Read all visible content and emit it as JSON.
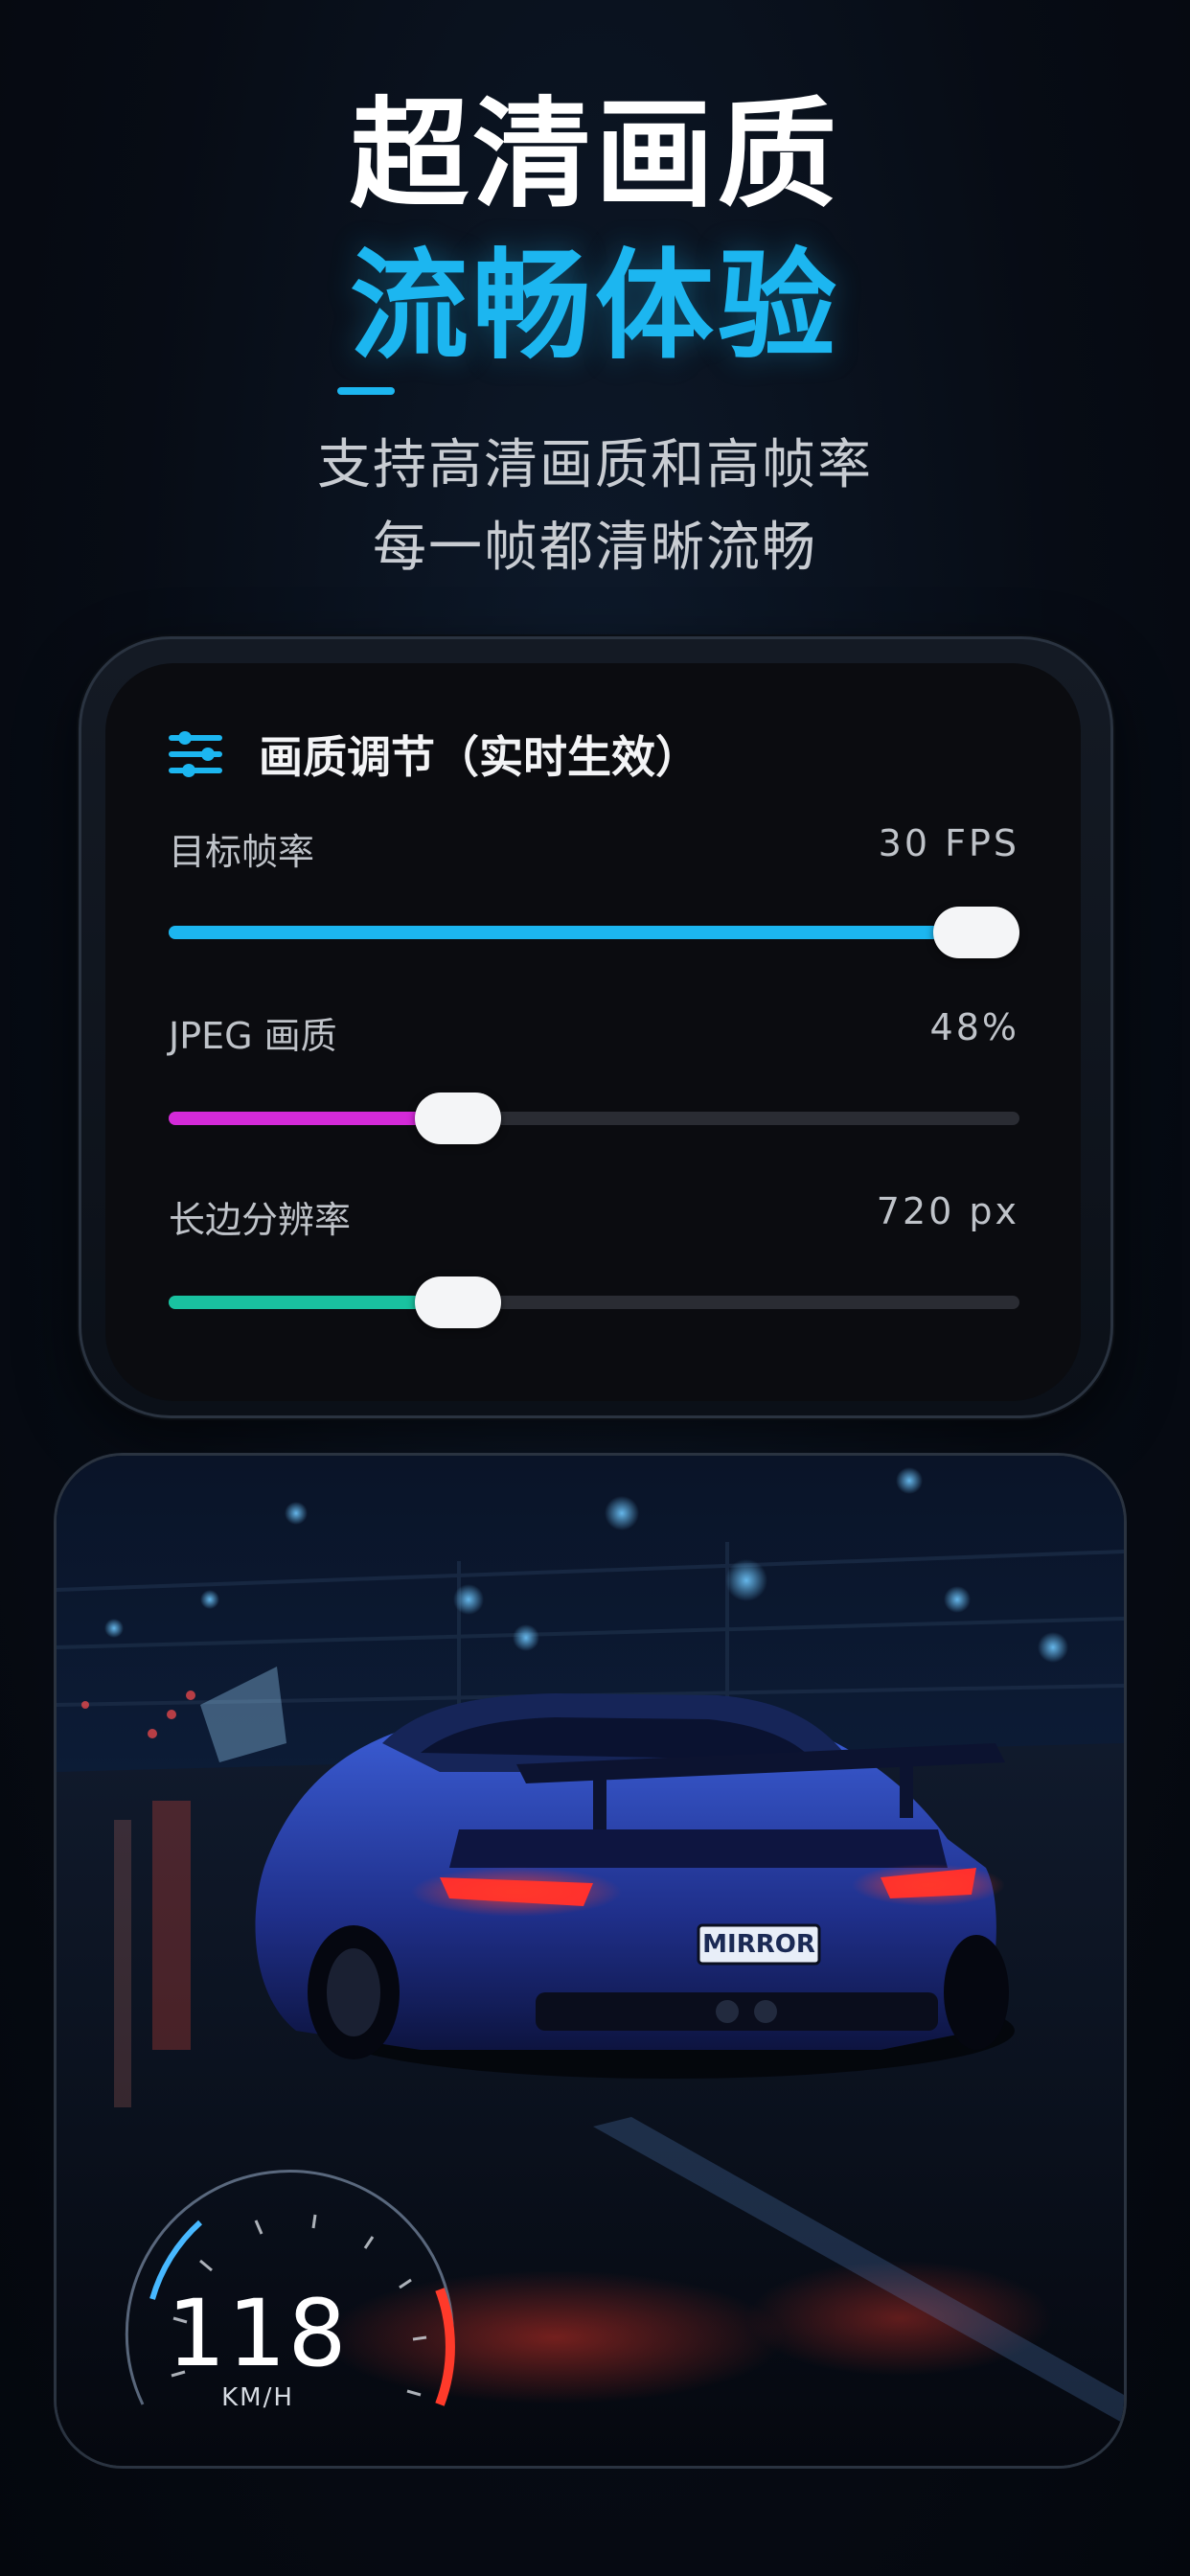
{
  "hero": {
    "title_line1": "超清画质",
    "title_line2": "流畅体验",
    "subtitle_line1": "支持高清画质和高帧率",
    "subtitle_line2": "每一帧都清晰流畅"
  },
  "settings_card": {
    "icon": "sliders-icon",
    "title": "画质调节（实时生效）",
    "sliders": [
      {
        "label": "目标帧率",
        "value": "30 FPS",
        "level": 0.95,
        "color": "#1cb6f0"
      },
      {
        "label": "JPEG 画质",
        "value": "48%",
        "level": 0.34,
        "color": "#d42ad9"
      },
      {
        "label": "长边分辨率",
        "value": "720 px",
        "level": 0.34,
        "color": "#19c2a0"
      }
    ]
  },
  "preview": {
    "plate": "MIRROR",
    "speed": "118",
    "speed_unit": "KM/H"
  },
  "colors": {
    "accent": "#1cb6f0",
    "background": "#070c15"
  }
}
